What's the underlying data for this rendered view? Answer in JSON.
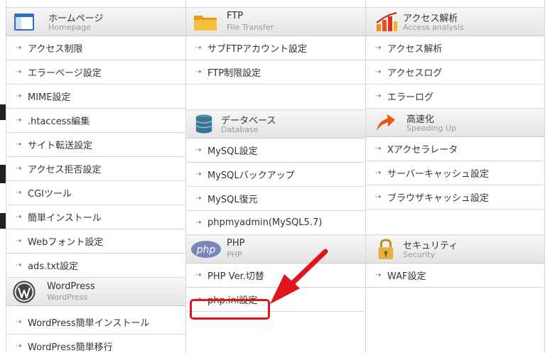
{
  "columns": [
    {
      "sections": [
        {
          "title": "ホームページ",
          "subtitle": "Homepage",
          "icon": "homepage-window-icon",
          "items": [
            "アクセス制限",
            "エラーページ設定",
            "MIME設定",
            ".htaccess編集",
            "サイト転送設定",
            "アクセス拒否設定",
            "CGIツール",
            "簡単インストール",
            "Webフォント設定",
            "ads.txt設定"
          ]
        },
        {
          "title": "WordPress",
          "subtitle": "WordPress",
          "icon": "wordpress-logo-icon",
          "items": [
            "WordPress簡単インストール",
            "WordPress簡単移行"
          ]
        }
      ]
    },
    {
      "sections": [
        {
          "title": "FTP",
          "subtitle": "File Transfer",
          "icon": "folder-icon",
          "items": [
            "サブFTPアカウント設定",
            "FTP制限設定"
          ]
        },
        {
          "title": "データベース",
          "subtitle": "Database",
          "icon": "database-icon",
          "items": [
            "MySQL設定",
            "MySQLバックアップ",
            "MySQL復元",
            "phpmyadmin(MySQL5.7)"
          ]
        },
        {
          "title": "PHP",
          "subtitle": "PHP",
          "icon": "php-logo-icon",
          "items": [
            "PHP Ver.切替",
            "php.ini設定"
          ]
        }
      ]
    },
    {
      "sections": [
        {
          "title": "アクセス解析",
          "subtitle": "Access analysis",
          "icon": "bar-chart-icon",
          "items": [
            "アクセス解析",
            "アクセスログ",
            "エラーログ"
          ]
        },
        {
          "title": "高速化",
          "subtitle": "Speeding Up",
          "icon": "speed-arrow-icon",
          "items": [
            "Xアクセラレータ",
            "サーバーキャッシュ設定",
            "ブラウザキャッシュ設定"
          ]
        },
        {
          "title": "セキュリティ",
          "subtitle": "Security",
          "icon": "padlock-icon",
          "items": [
            "WAF設定"
          ]
        }
      ]
    }
  ],
  "item_marker": "⇢",
  "highlight": {
    "target": "php.ini設定",
    "color": "#e0151c"
  }
}
